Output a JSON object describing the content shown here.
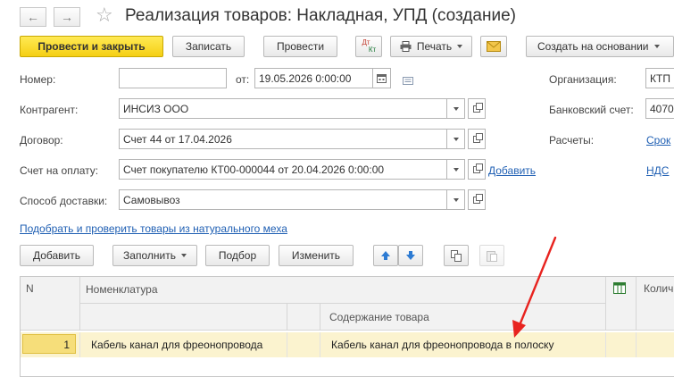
{
  "window": {
    "title": "Реализация товаров: Накладная, УПД (создание)"
  },
  "toolbar": {
    "post_and_close": "Провести и закрыть",
    "save": "Записать",
    "post": "Провести",
    "dt_kt_top": "Дт",
    "dt_kt_bottom": "Кт",
    "print": "Печать",
    "create_based_on": "Создать на основании"
  },
  "form": {
    "number_label": "Номер:",
    "number_value": "",
    "date_label": "от:",
    "date_value": "19.05.2026  0:00:00",
    "org_label": "Организация:",
    "org_value": "КТП",
    "counterparty_label": "Контрагент:",
    "counterparty_value": "ИНСИЗ ООО",
    "bank_label": "Банковский счет:",
    "bank_value": "4070",
    "contract_label": "Договор:",
    "contract_value": "Счет 44 от 17.04.2026",
    "settlements_label": "Расчеты:",
    "settlements_link": "Срок",
    "invoice_label": "Счет на оплату:",
    "invoice_value": "Счет покупателю КТ00-000044 от 20.04.2026 0:00:00",
    "invoice_add_link": "Добавить",
    "vat_link": "НДС",
    "delivery_label": "Способ доставки:",
    "delivery_value": "Самовывоз",
    "fur_link": "Подобрать и проверить товары из натурального меха"
  },
  "table_toolbar": {
    "add": "Добавить",
    "fill": "Заполнить",
    "pick": "Подбор",
    "change": "Изменить"
  },
  "table": {
    "col_n": "N",
    "col_nomenclature": "Номенклатура",
    "col_content": "Содержание товара",
    "col_qty": "Колич",
    "rows": [
      {
        "n": "1",
        "nomenclature": "Кабель канал для фреонопровода",
        "content": "Кабель канал для фреонопровода в полоску"
      }
    ]
  },
  "colors": {
    "primary_button": "#f5cf14",
    "link": "#1f5fb3",
    "selected_row": "#fbf3cf",
    "annotation_arrow": "#e8231f"
  }
}
